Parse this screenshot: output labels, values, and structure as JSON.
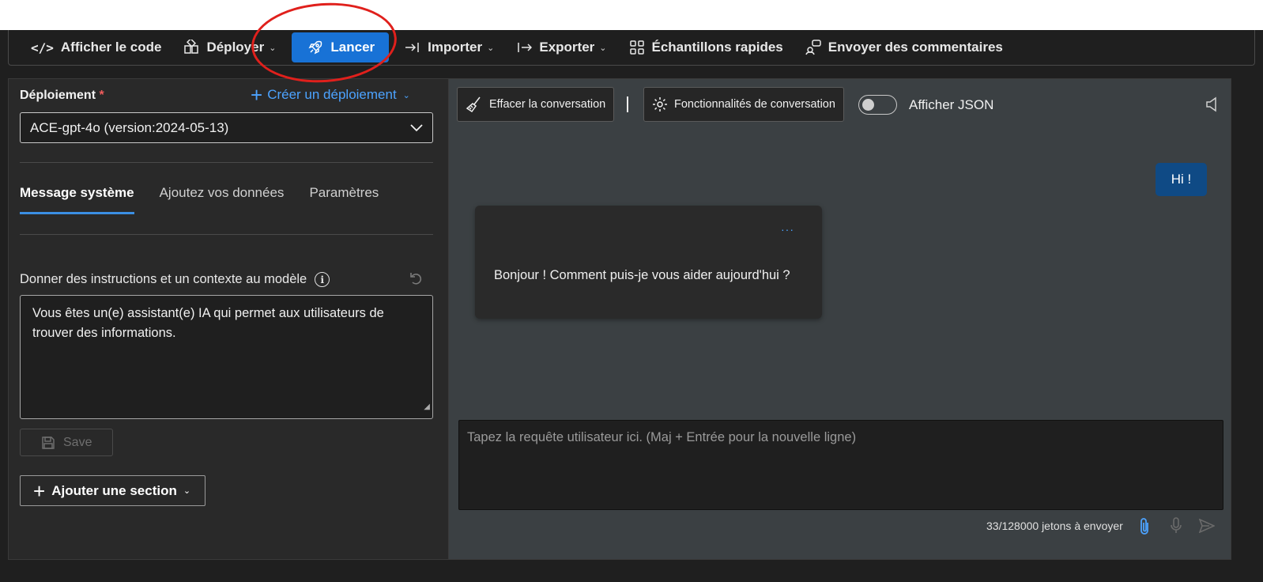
{
  "toolbar": {
    "view_code": "Afficher le code",
    "deploy": "Déployer",
    "launch": "Lancer",
    "import": "Importer",
    "export": "Exporter",
    "samples": "Échantillons rapides",
    "feedback": "Envoyer des commentaires"
  },
  "left": {
    "deploy_label": "Déploiement",
    "required_mark": "*",
    "create_deploy": "Créer un déploiement",
    "deploy_value": "ACE-gpt-4o (version:2024-05-13)",
    "tabs": [
      "Message système",
      "Ajoutez vos données",
      "Paramètres"
    ],
    "instructions_label": "Donner des instructions et un contexte au modèle",
    "system_message": "Vous êtes un(e) assistant(e) IA qui permet aux utilisateurs de trouver des informations.",
    "save_label": "Save",
    "add_section": "Ajouter une section"
  },
  "chat": {
    "clear_label": "Effacer la conversation",
    "features_label": "Fonctionnalités de conversation",
    "json_toggle_label": "Afficher JSON",
    "json_toggle_on": false,
    "user_message": "Hi !",
    "assistant_message": "Bonjour ! Comment puis-je vous aider aujourd'hui ?",
    "more_options": "···",
    "input_placeholder": "Tapez la requête utilisateur ici. (Maj + Entrée pour la nouvelle ligne)",
    "token_count": "33/128000 jetons à envoyer"
  },
  "colors": {
    "accent": "#1872d6",
    "link": "#4ca3ff",
    "user_bubble": "#0f4a85",
    "annotation": "#e0201c"
  }
}
